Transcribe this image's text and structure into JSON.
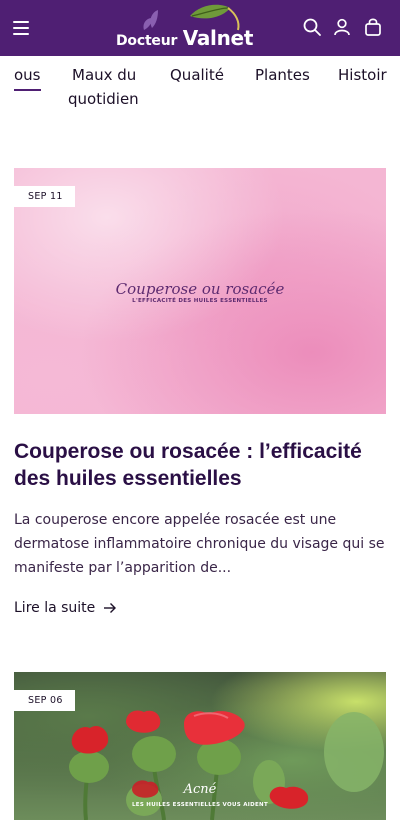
{
  "header": {
    "logo": {
      "word1": "Docteur",
      "word2": "Valnet"
    },
    "icons": [
      "menu-icon",
      "search-icon",
      "account-icon",
      "cart-icon"
    ],
    "background": "#4f1f73"
  },
  "nav": {
    "items": [
      {
        "label": "ous",
        "active": true
      },
      {
        "label": "Maux du",
        "label2": "quotidien"
      },
      {
        "label": "Qualité"
      },
      {
        "label": "Plantes"
      },
      {
        "label": "Histoir"
      }
    ]
  },
  "articles": [
    {
      "date": "SEP 11",
      "image_title": "Couperose ou rosacée",
      "image_subtitle": "L'EFFICACITÉ DES HUILES ESSENTIELLES",
      "title": "Couperose ou rosacée : l’efficacité des huiles essentielles",
      "excerpt": "La couperose encore appelée rosacée est une dermatose inflammatoire chronique du visage qui se manifeste par l’apparition de...",
      "read_more": "Lire la suite"
    },
    {
      "date": "SEP 06",
      "image_title": "Acné",
      "image_subtitle": "LES HUILES ESSENTIELLES VOUS AIDENT"
    }
  ],
  "colors": {
    "brand": "#4f1f73",
    "title": "#2a0f45"
  }
}
